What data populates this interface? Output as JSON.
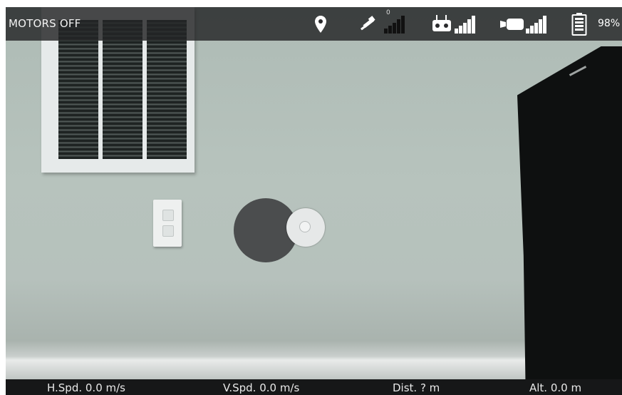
{
  "status_bar": {
    "motors_label": "MOTORS OFF",
    "gps_satellite_count": "0",
    "battery_percent": "98%",
    "icons": [
      "location-pin-icon",
      "satellite-icon",
      "remote-controller-icon",
      "video-camera-icon",
      "battery-icon"
    ]
  },
  "telemetry": {
    "h_speed": "H.Spd. 0.0 m/s",
    "v_speed": "V.Spd. 0.0 m/s",
    "distance": "Dist. ? m",
    "altitude": "Alt. 0.0 m"
  },
  "colors": {
    "bar_background": "#232426",
    "text": "#ffffff",
    "joystick_base": "#4b4d4e",
    "joystick_knob": "#e6e8e8"
  }
}
